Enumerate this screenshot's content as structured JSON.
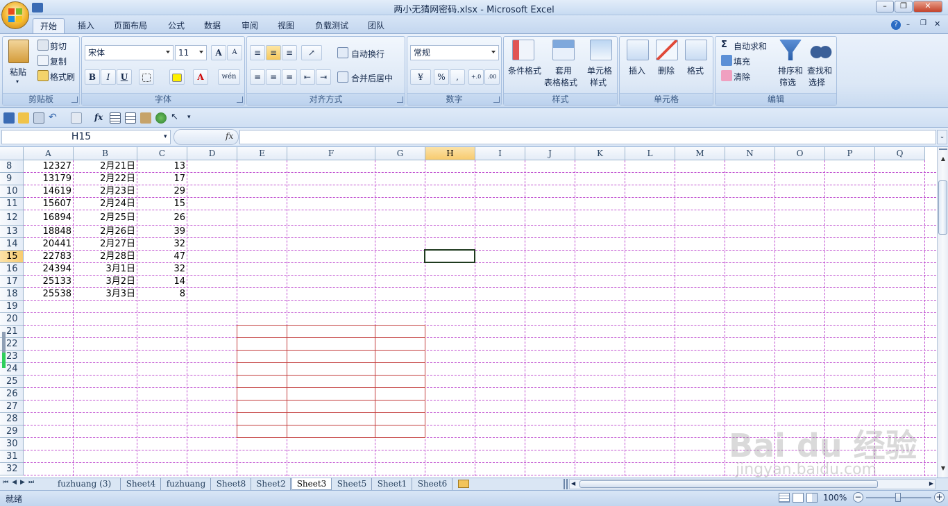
{
  "window": {
    "title": "两小无猜网密码.xlsx - Microsoft Excel",
    "minimize_label": "–",
    "restore_label": "❐",
    "close_label": "✕"
  },
  "tabs": [
    {
      "label": "开始",
      "active": true
    },
    {
      "label": "插入"
    },
    {
      "label": "页面布局"
    },
    {
      "label": "公式"
    },
    {
      "label": "数据"
    },
    {
      "label": "审阅"
    },
    {
      "label": "视图"
    },
    {
      "label": "负载测试"
    },
    {
      "label": "团队"
    }
  ],
  "ribbon": {
    "clipboard": {
      "group_label": "剪贴板",
      "paste": "粘贴",
      "cut": "剪切",
      "copy": "复制",
      "format_painter": "格式刷"
    },
    "font": {
      "group_label": "字体",
      "font_name": "宋体",
      "font_size": "11",
      "grow": "A",
      "shrink": "A",
      "bold": "B",
      "italic": "I",
      "underline": "U",
      "wen": "wén"
    },
    "alignment": {
      "group_label": "对齐方式",
      "wrap_text": "自动换行",
      "merge_center": "合并后居中"
    },
    "number": {
      "group_label": "数字",
      "format": "常规",
      "percent": "%",
      "comma": ",",
      "inc_decimal": "+.0",
      "dec_decimal": ".00"
    },
    "styles": {
      "group_label": "样式",
      "conditional": "条件格式",
      "as_table_1": "套用",
      "as_table_2": "表格格式",
      "cell_styles_1": "单元格",
      "cell_styles_2": "样式"
    },
    "cells": {
      "group_label": "单元格",
      "insert": "插入",
      "delete": "删除",
      "format": "格式"
    },
    "editing": {
      "group_label": "编辑",
      "autosum": "自动求和",
      "fill": "填充",
      "clear": "清除",
      "sort_1": "排序和",
      "sort_2": "筛选",
      "find_1": "查找和",
      "find_2": "选择"
    }
  },
  "formula_bar": {
    "name_box": "H15",
    "fx": "fx",
    "formula": ""
  },
  "sheet": {
    "columns": [
      "A",
      "B",
      "C",
      "D",
      "E",
      "F",
      "G",
      "H",
      "I",
      "J",
      "K",
      "L",
      "M",
      "N",
      "O",
      "P",
      "Q"
    ],
    "selected_column": "H",
    "selected_row": "15",
    "rows": [
      {
        "num": "8",
        "a": "12327",
        "b": "2月21日",
        "c": "13"
      },
      {
        "num": "9",
        "a": "13179",
        "b": "2月22日",
        "c": "17"
      },
      {
        "num": "10",
        "a": "14619",
        "b": "2月23日",
        "c": "29"
      },
      {
        "num": "11",
        "a": "15607",
        "b": "2月24日",
        "c": "15"
      },
      {
        "num": "12",
        "a": "16894",
        "b": "2月25日",
        "c": "26"
      },
      {
        "num": "13",
        "a": "18848",
        "b": "2月26日",
        "c": "39"
      },
      {
        "num": "14",
        "a": "20441",
        "b": "2月27日",
        "c": "32"
      },
      {
        "num": "15",
        "a": "22783",
        "b": "2月28日",
        "c": "47"
      },
      {
        "num": "16",
        "a": "24394",
        "b": "3月1日",
        "c": "32"
      },
      {
        "num": "17",
        "a": "25133",
        "b": "3月2日",
        "c": "14"
      },
      {
        "num": "18",
        "a": "25538",
        "b": "3月3日",
        "c": "8"
      },
      {
        "num": "19"
      },
      {
        "num": "20"
      },
      {
        "num": "21"
      },
      {
        "num": "22"
      },
      {
        "num": "23"
      },
      {
        "num": "24"
      },
      {
        "num": "25"
      },
      {
        "num": "26"
      },
      {
        "num": "27"
      },
      {
        "num": "28"
      },
      {
        "num": "29"
      },
      {
        "num": "30"
      },
      {
        "num": "31"
      },
      {
        "num": "32"
      }
    ]
  },
  "sheet_tabs": [
    {
      "label": "fuzhuang (3)"
    },
    {
      "label": "Sheet4"
    },
    {
      "label": "fuzhuang"
    },
    {
      "label": "Sheet8"
    },
    {
      "label": "Sheet2"
    },
    {
      "label": "Sheet3",
      "active": true
    },
    {
      "label": "Sheet5"
    },
    {
      "label": "Sheet1"
    },
    {
      "label": "Sheet6"
    }
  ],
  "status": {
    "ready": "就绪",
    "zoom": "100%",
    "minus": "−",
    "plus": "+"
  },
  "watermark": {
    "brand": "Bai du 经验",
    "url": "jingyan.baidu.com"
  },
  "colors": {
    "grid_dash": "#c050d0",
    "red_box": "#c23b3b",
    "selected_header": "#f8cb6e"
  }
}
